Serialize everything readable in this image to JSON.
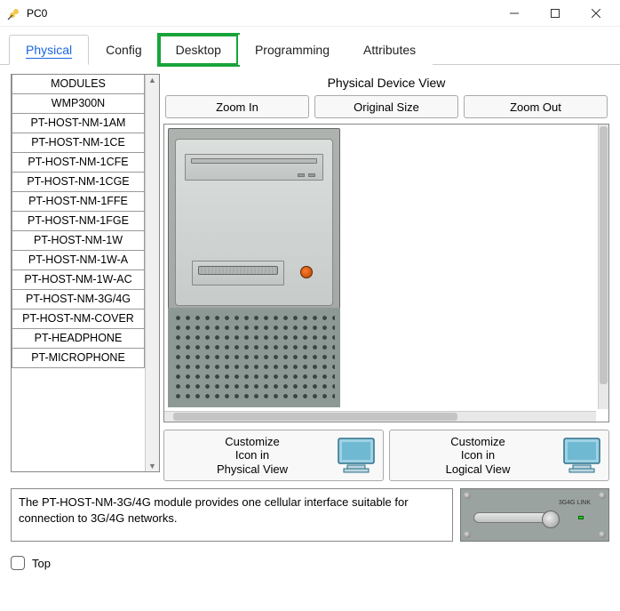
{
  "window": {
    "title": "PC0"
  },
  "tabs": {
    "items": [
      "Physical",
      "Config",
      "Desktop",
      "Programming",
      "Attributes"
    ],
    "active": 0,
    "highlighted": 2
  },
  "modules": {
    "items": [
      "MODULES",
      "WMP300N",
      "PT-HOST-NM-1AM",
      "PT-HOST-NM-1CE",
      "PT-HOST-NM-1CFE",
      "PT-HOST-NM-1CGE",
      "PT-HOST-NM-1FFE",
      "PT-HOST-NM-1FGE",
      "PT-HOST-NM-1W",
      "PT-HOST-NM-1W-A",
      "PT-HOST-NM-1W-AC",
      "PT-HOST-NM-3G/4G",
      "PT-HOST-NM-COVER",
      "PT-HEADPHONE",
      "PT-MICROPHONE"
    ]
  },
  "physicalDeviceView": {
    "title": "Physical Device View",
    "zoom": {
      "in": "Zoom In",
      "original": "Original Size",
      "out": "Zoom Out"
    },
    "customize": {
      "physical": "Customize\nIcon in\nPhysical View",
      "logical": "Customize\nIcon in\nLogical View"
    }
  },
  "description": {
    "text": "The PT-HOST-NM-3G/4G module provides one cellular interface suitable for connection to 3G/4G networks."
  },
  "modulePreview": {
    "label": "3G4G\nLINK"
  },
  "bottom": {
    "topLabel": "Top",
    "topChecked": false
  }
}
